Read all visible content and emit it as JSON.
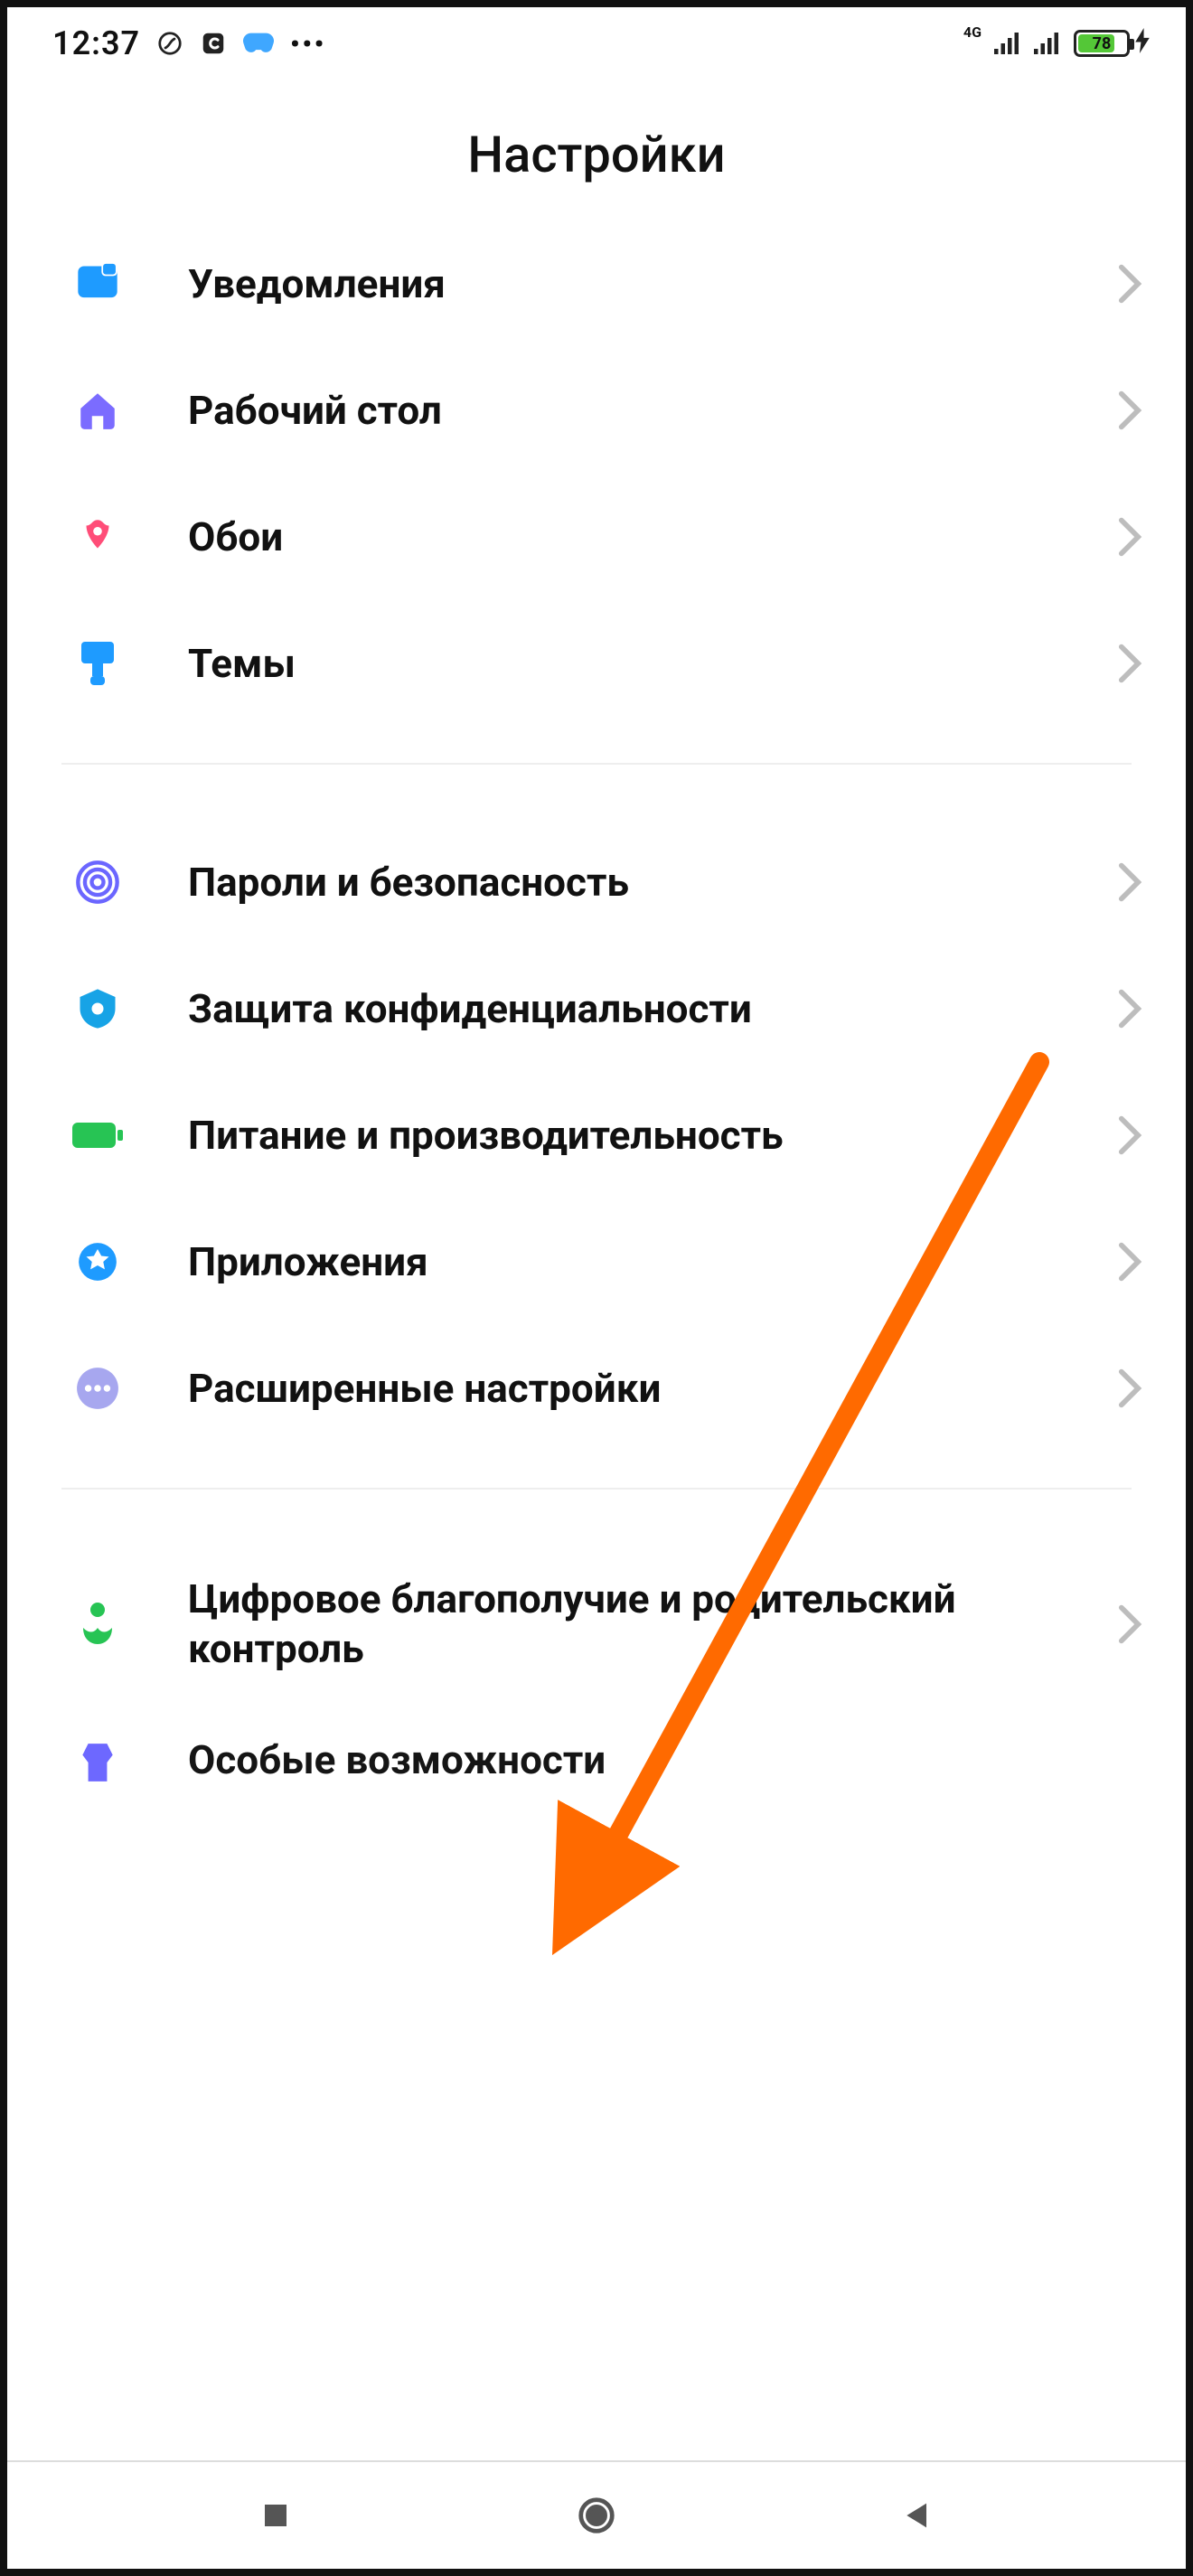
{
  "statusbar": {
    "time": "12:37",
    "network_label": "4G",
    "battery_percent": "78"
  },
  "page": {
    "title": "Настройки"
  },
  "settings": {
    "group1": [
      {
        "id": "notifications",
        "label": "Уведомления",
        "icon": "notifications-icon",
        "color": "#1e9bff"
      },
      {
        "id": "home-screen",
        "label": "Рабочий стол",
        "icon": "home-icon",
        "color": "#7b6cff"
      },
      {
        "id": "wallpaper",
        "label": "Обои",
        "icon": "wallpaper-icon",
        "color": "#ff4d78"
      },
      {
        "id": "themes",
        "label": "Темы",
        "icon": "themes-icon",
        "color": "#1e9bff"
      }
    ],
    "group2": [
      {
        "id": "passwords-security",
        "label": "Пароли и безопасность",
        "icon": "fingerprint-icon",
        "color": "#6b66ff"
      },
      {
        "id": "privacy",
        "label": "Защита конфиденциальности",
        "icon": "privacy-icon",
        "color": "#17a3e6"
      },
      {
        "id": "battery-perf",
        "label": "Питание и производительность",
        "icon": "battery-icon",
        "color": "#27c454"
      },
      {
        "id": "apps",
        "label": "Приложения",
        "icon": "apps-icon",
        "color": "#1e9bff"
      },
      {
        "id": "advanced",
        "label": "Расширенные настройки",
        "icon": "more-icon",
        "color": "#a7a7ef"
      }
    ],
    "group3": [
      {
        "id": "digital-wellbeing",
        "label": "Цифровое благополучие и родительский контроль",
        "icon": "wellbeing-icon",
        "color": "#27c454"
      },
      {
        "id": "accessibility",
        "label": "Особые возможности",
        "icon": "accessibility-icon",
        "color": "#6b66ff"
      }
    ]
  },
  "annotation": {
    "arrow_target": "advanced",
    "arrow_color": "#ff6a00"
  }
}
